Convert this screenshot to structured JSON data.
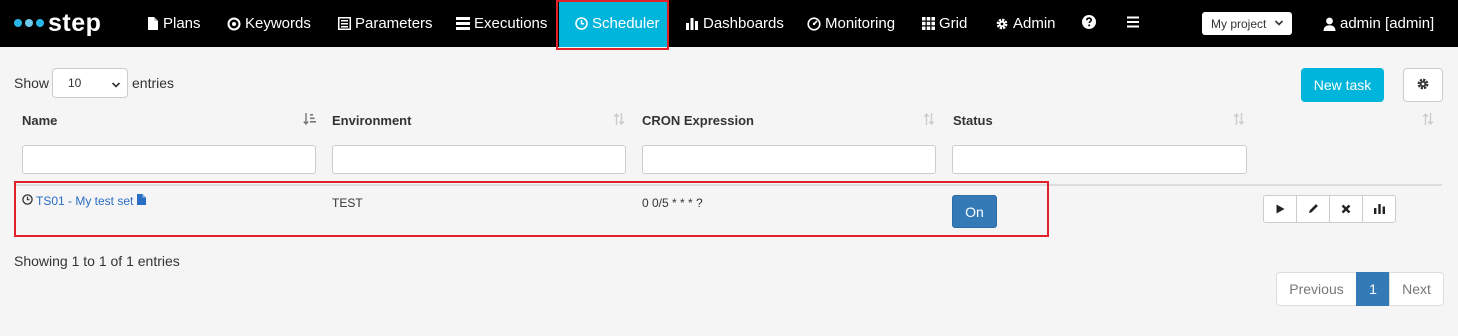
{
  "nav": {
    "logo": "step",
    "items": [
      {
        "label": "Plans",
        "icon": "file-icon"
      },
      {
        "label": "Keywords",
        "icon": "target-icon"
      },
      {
        "label": "Parameters",
        "icon": "list-icon"
      },
      {
        "label": "Executions",
        "icon": "tasks-icon"
      },
      {
        "label": "Scheduler",
        "icon": "clock-icon",
        "active": true
      },
      {
        "label": "Dashboards",
        "icon": "bar-chart-icon"
      },
      {
        "label": "Monitoring",
        "icon": "dashboard-icon"
      },
      {
        "label": "Grid",
        "icon": "grid-icon"
      },
      {
        "label": "Admin",
        "icon": "gear-icon"
      }
    ],
    "project": "My project",
    "user": "admin [admin]"
  },
  "controls": {
    "show_label": "Show",
    "length_value": "10",
    "entries_label": "entries",
    "new_task": "New task"
  },
  "table": {
    "columns": [
      "Name",
      "Environment",
      "CRON Expression",
      "Status"
    ],
    "rows": [
      {
        "name": "TS01 - My test set",
        "environment": "TEST",
        "cron": "0 0/5 * * * ?",
        "status": "On"
      }
    ]
  },
  "footer": {
    "info": "Showing 1 to 1 of 1 entries",
    "previous": "Previous",
    "page": "1",
    "next": "Next"
  },
  "colors": {
    "navbar": "#000000",
    "accent": "#00b5dc",
    "primary": "#337ab7",
    "highlight": "#e2202a",
    "link": "#2a6dc4"
  }
}
